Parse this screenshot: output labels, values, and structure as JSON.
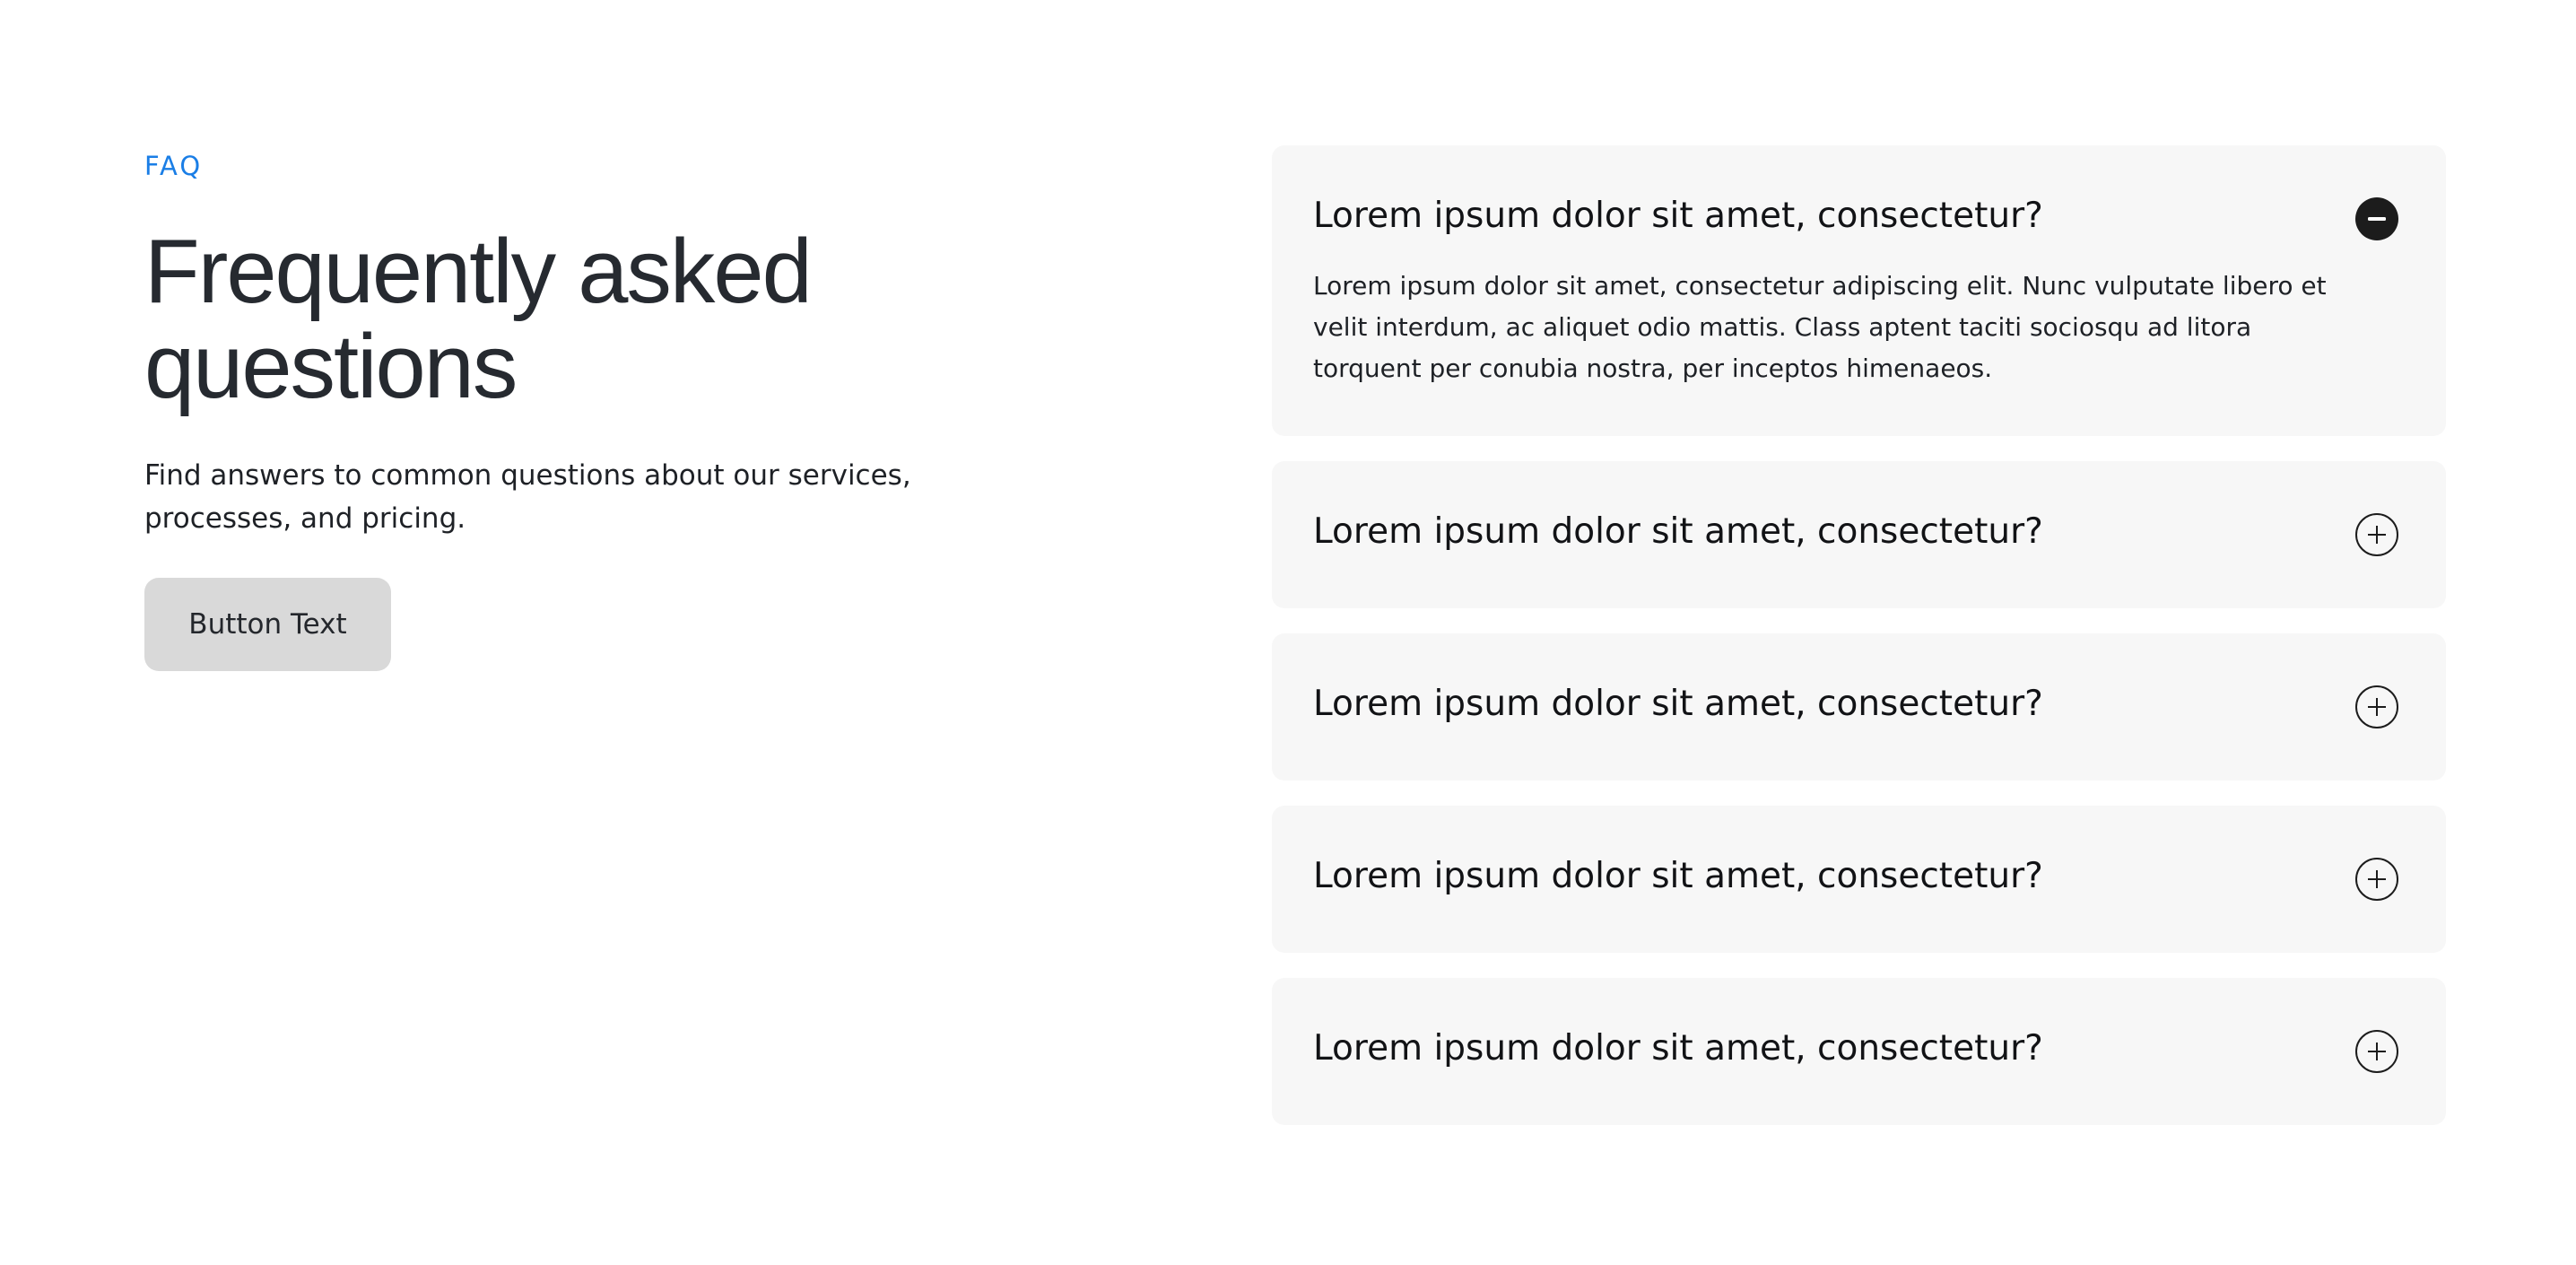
{
  "hero": {
    "eyebrow": "FAQ",
    "title_line1": "Frequently asked",
    "title_line2": "questions",
    "subtitle": "Find answers to common questions about our services, processes, and pricing.",
    "button_label": "Button Text"
  },
  "faq": {
    "items": [
      {
        "question": "Lorem ipsum dolor sit amet, consectetur?",
        "answer": "Lorem ipsum dolor sit amet, consectetur adipiscing elit. Nunc vulputate libero et velit interdum, ac aliquet odio mattis. Class aptent taciti sociosqu ad litora torquent per conubia nostra, per inceptos himenaeos.",
        "expanded": true,
        "icon": "minus-circle-icon"
      },
      {
        "question": "Lorem ipsum dolor sit amet, consectetur?",
        "expanded": false,
        "icon": "plus-circle-icon"
      },
      {
        "question": "Lorem ipsum dolor sit amet, consectetur?",
        "expanded": false,
        "icon": "plus-circle-icon"
      },
      {
        "question": "Lorem ipsum dolor sit amet, consectetur?",
        "expanded": false,
        "icon": "plus-circle-icon"
      },
      {
        "question": "Lorem ipsum dolor sit amet, consectetur?",
        "expanded": false,
        "icon": "plus-circle-icon"
      }
    ]
  },
  "colors": {
    "accent": "#1a7ee6",
    "heading": "#262a30",
    "card_bg": "#f7f7f7",
    "button_bg": "#d9d9d9"
  }
}
